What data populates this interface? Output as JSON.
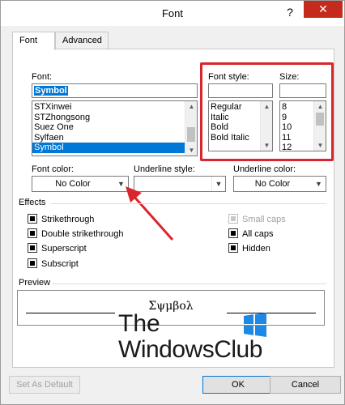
{
  "window": {
    "title": "Font",
    "help_glyph": "?",
    "close_glyph": "✕"
  },
  "tabs": [
    {
      "label": "Font",
      "active": true
    },
    {
      "label": "Advanced",
      "active": false
    }
  ],
  "font": {
    "label": "Font:",
    "value": "Symbol",
    "items": [
      "STXinwei",
      "STZhongsong",
      "Suez One",
      "Sylfaen",
      "Symbol"
    ],
    "selected_index": 4
  },
  "font_style": {
    "label": "Font style:",
    "value": "",
    "items": [
      "Regular",
      "Italic",
      "Bold",
      "Bold Italic"
    ]
  },
  "size": {
    "label": "Size:",
    "value": "",
    "items": [
      "8",
      "9",
      "10",
      "11",
      "12"
    ]
  },
  "font_color": {
    "label": "Font color:",
    "value": "No Color"
  },
  "underline_style": {
    "label": "Underline style:",
    "value": ""
  },
  "underline_color": {
    "label": "Underline color:",
    "value": "No Color"
  },
  "effects": {
    "label": "Effects",
    "left": [
      {
        "label": "Strikethrough"
      },
      {
        "label": "Double strikethrough"
      },
      {
        "label": "Superscript"
      },
      {
        "label": "Subscript"
      }
    ],
    "right": [
      {
        "label": "Small caps",
        "disabled": true
      },
      {
        "label": "All caps",
        "disabled": false
      },
      {
        "label": "Hidden",
        "disabled": false
      }
    ]
  },
  "preview": {
    "label": "Preview",
    "text": "Σψμβολ"
  },
  "watermark": {
    "line1": "The",
    "line2": "WindowsClub"
  },
  "buttons": {
    "set_default": "Set As Default",
    "ok": "OK",
    "cancel": "Cancel"
  },
  "colors": {
    "selection": "#0078d7",
    "annotation_red": "#d9262e",
    "close_red": "#c42b1c"
  }
}
